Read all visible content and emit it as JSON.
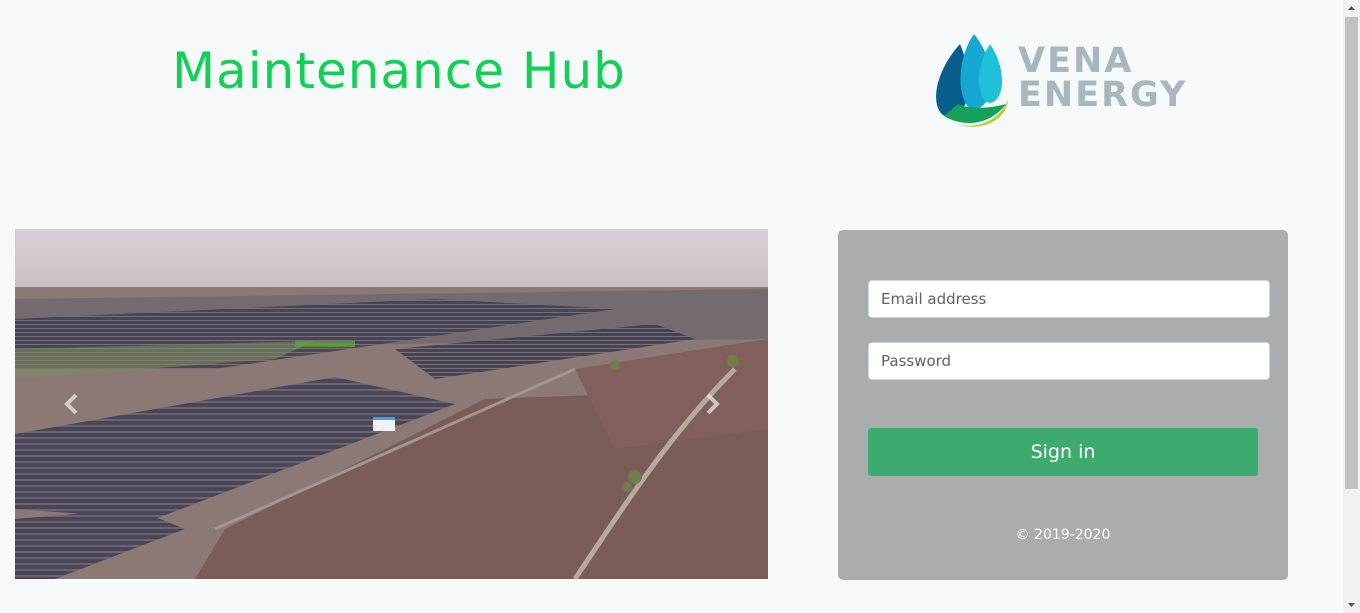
{
  "header": {
    "title": "Maintenance Hub",
    "logo": {
      "line1": "VENA",
      "line2": "ENERGY"
    }
  },
  "carousel": {
    "prev_icon": "chevron-left-icon",
    "next_icon": "chevron-right-icon"
  },
  "login": {
    "email_placeholder": "Email address",
    "password_placeholder": "Password",
    "signin_label": "Sign in",
    "copyright": "© 2019-2020"
  },
  "colors": {
    "title": "#12d054",
    "card": "#a9adad",
    "button": "#3dab70",
    "logo_text": "#a9b6bd"
  }
}
